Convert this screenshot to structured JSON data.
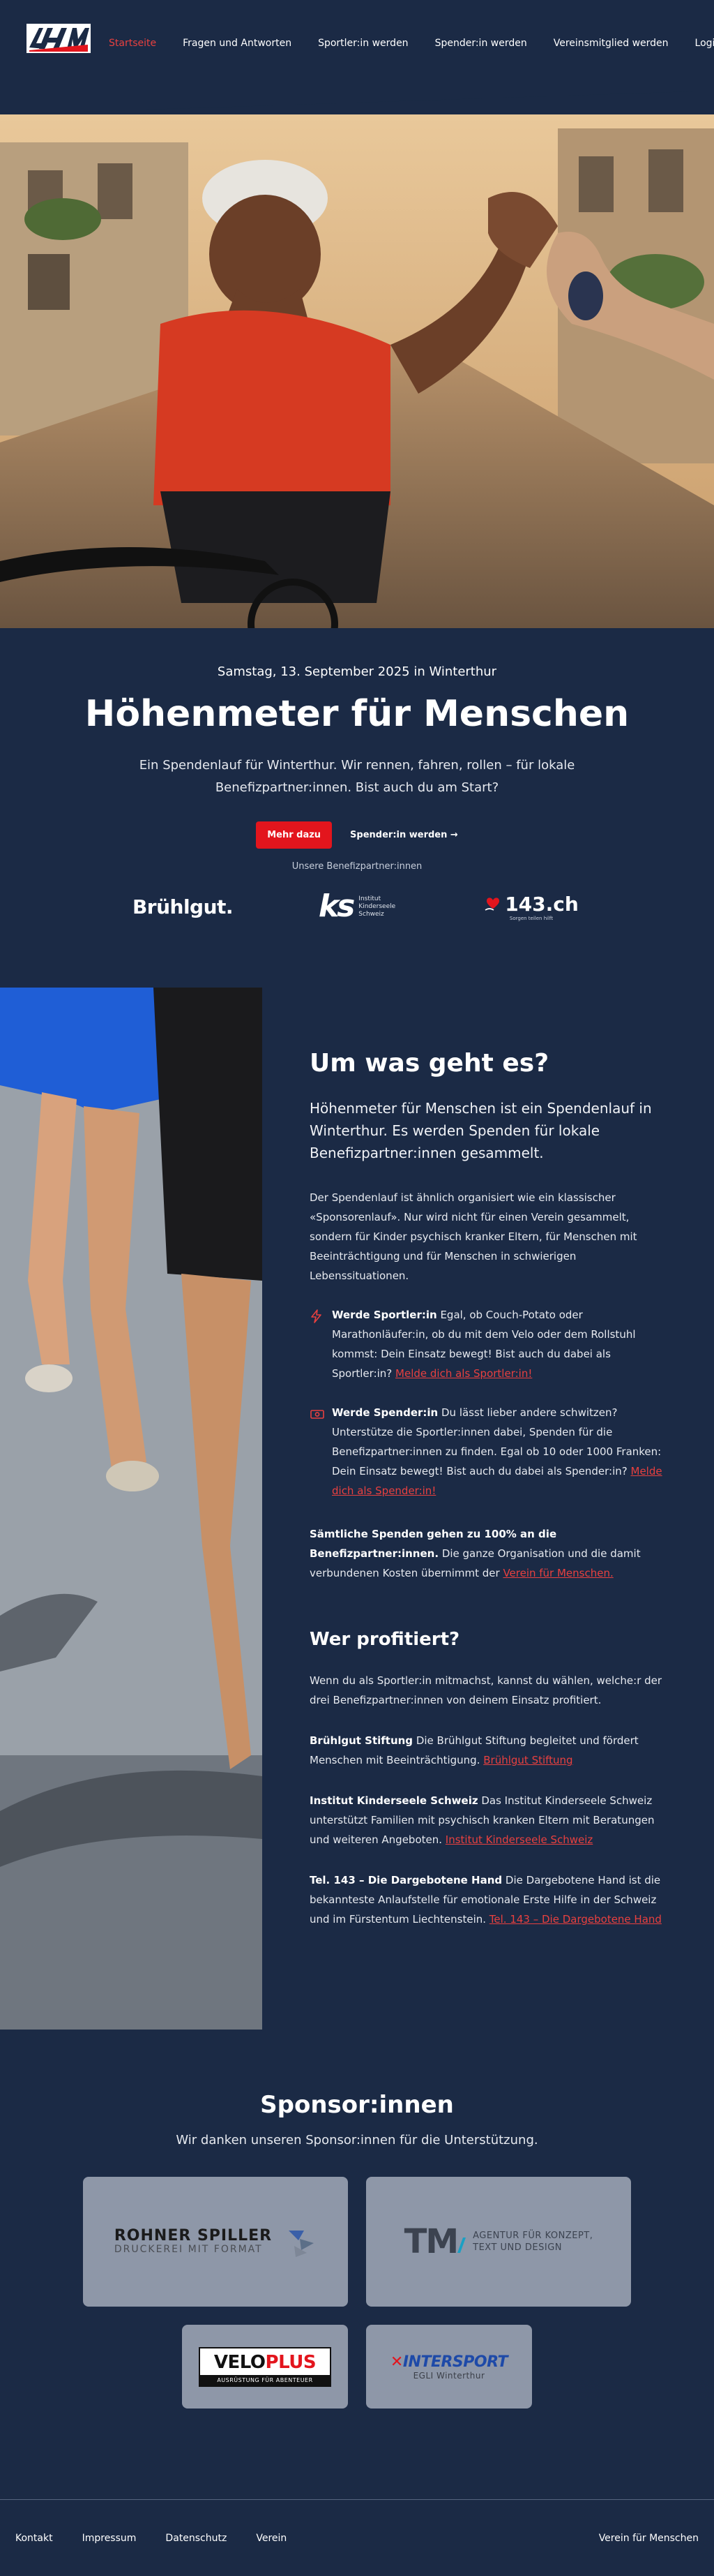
{
  "nav": {
    "logo_text": "HfM",
    "items": [
      {
        "label": "Startseite",
        "active": true
      },
      {
        "label": "Fragen und Antworten",
        "active": false
      },
      {
        "label": "Sportler:in werden",
        "active": false
      },
      {
        "label": "Spender:in werden",
        "active": false
      },
      {
        "label": "Vereinsmitglied werden",
        "active": false
      }
    ],
    "login": "Login"
  },
  "event": {
    "date": "Samstag, 13. September 2025 in Winterthur",
    "title": "Höhenmeter für Menschen",
    "subtitle": "Ein Spendenlauf für Winterthur. Wir rennen, fahren, rollen – für lokale Benefizpartner:innen. Bist auch du am Start?",
    "primary_button": "Mehr dazu",
    "secondary_button": "Spender:in werden →",
    "partners_label": "Unsere Benefizpartner:innen",
    "partners": {
      "bruehlgut": "Brühlgut.",
      "kinderseele_mark": "ks",
      "kinderseele_text": [
        "Institut",
        "Kinderseele",
        "Schweiz"
      ],
      "tel143": "143.ch",
      "tel143_small": "Sorgen teilen hilft"
    }
  },
  "about": {
    "title": "Um was geht es?",
    "lead": "Höhenmeter für Menschen ist ein Spendenlauf in Winterthur. Es werden Spenden für lokale Benefizpartner:innen gesammelt.",
    "intro": "Der Spendenlauf ist ähnlich organisiert wie ein klassischer «Sponsorenlauf». Nur wird nicht für einen Verein gesammelt, sondern für Kinder psychisch kranker Eltern, für Menschen mit Beeinträchtigung und für Menschen in schwierigen Lebenssituationen.",
    "features": [
      {
        "icon": "lightning-icon",
        "bold": "Werde Sportler:in",
        "text": " Egal, ob Couch-Potato oder Marathonläufer:in, ob du mit dem Velo oder dem Rollstuhl kommst: Dein Einsatz bewegt! Bist auch du dabei als Sportler:in? ",
        "link": "Melde dich als Sportler:in!"
      },
      {
        "icon": "money-icon",
        "bold": "Werde Spender:in",
        "text": " Du lässt lieber andere schwitzen? Unterstütze die Sportler:innen dabei, Spenden für die Benefizpartner:innen zu finden. Egal ob 10 oder 1000 Franken: Dein Einsatz bewegt! Bist auch du dabei als Spender:in? ",
        "link": "Melde dich als Spender:in!"
      }
    ],
    "donation_bold": "Sämtliche Spenden gehen zu 100% an die Benefizpartner:innen.",
    "donation_text": " Die ganze Organisation und die damit verbundenen Kosten übernimmt der ",
    "donation_link": "Verein für Menschen.",
    "who_title": "Wer profitiert?",
    "who_intro": "Wenn du als Sportler:in mitmachst, kannst du wählen, welche:r der drei Benefizpartner:innen von deinem Einsatz profitiert.",
    "orgs": [
      {
        "bold": "Brühlgut Stiftung",
        "text": " Die Brühlgut Stiftung begleitet und fördert Menschen mit Beeinträchtigung. ",
        "link": "Brühlgut Stiftung"
      },
      {
        "bold": "Institut Kinderseele Schweiz",
        "text": " Das Institut Kinderseele Schweiz unterstützt Familien mit psychisch kranken Eltern mit Beratungen und weiteren Angeboten. ",
        "link": "Institut Kinderseele Schweiz"
      },
      {
        "bold": "Tel. 143 – Die Dargebotene Hand",
        "text": " Die Dargebotene Hand ist die bekannteste Anlaufstelle für emotionale Erste Hilfe in der Schweiz und im Fürstentum Liechtenstein. ",
        "link": "Tel. 143 – Die Dargebotene Hand"
      }
    ]
  },
  "sponsors": {
    "title": "Sponsor:innen",
    "subtitle": "Wir danken unseren Sponsor:innen für die Unterstützung.",
    "rohner_name": "ROHNER SPILLER",
    "rohner_tag": "DRUCKEREI MIT FORMAT",
    "tm_mark": "TM",
    "tm_tag_1": "AGENTUR FÜR KONZEPT,",
    "tm_tag_2": "TEXT UND DESIGN",
    "velo_a": "VELO",
    "velo_b": "PLUS",
    "velo_tag": "AUSRÜSTUNG FÜR ABENTEUER",
    "intersport_name": "INTERSPORT",
    "intersport_sub": "EGLI Winterthur"
  },
  "footer": {
    "links": [
      "Kontakt",
      "Impressum",
      "Datenschutz",
      "Verein"
    ],
    "right": "Verein für Menschen"
  },
  "colors": {
    "background": "#1b2a45",
    "accent": "#e3151d",
    "link": "#e8403f",
    "sponsor_card": "#8e97a8"
  }
}
